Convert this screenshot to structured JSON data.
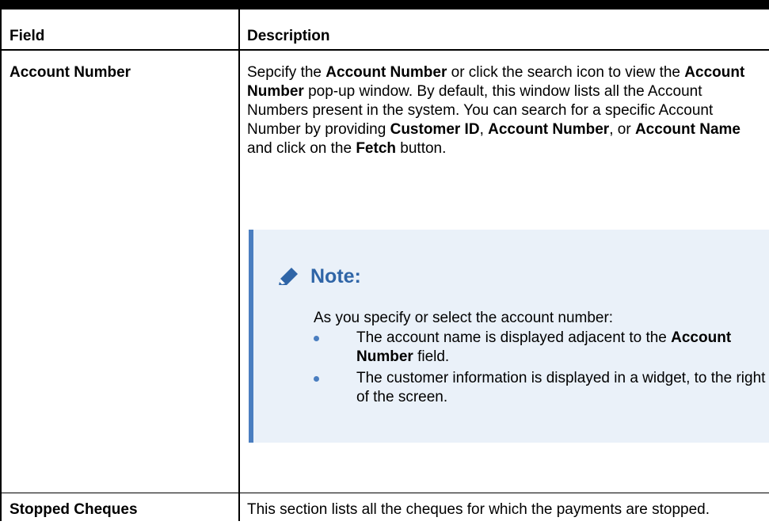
{
  "table": {
    "headers": {
      "field": "Field",
      "description": "Description"
    },
    "rows": [
      {
        "field": "Account Number",
        "desc_parts": {
          "p1": "Sepcify the ",
          "b1": "Account Number",
          "p2": " or click the search icon to view the ",
          "b2": "Account Number",
          "p3": " pop-up window. By default, this window lists all the Account Numbers present in the system. You can search for a specific Account Number by providing ",
          "b3": "Customer ID",
          "p4": ", ",
          "b4": "Account Number",
          "p5": ", or ",
          "b5": "Account Name",
          "p6": " and click on the ",
          "b6": "Fetch",
          "p7": " button."
        },
        "note": {
          "title": "Note:",
          "icon": "pencil-icon",
          "intro": "As you specify or select the account number:",
          "bullet1": {
            "t1": "The account name is displayed adjacent to the ",
            "b1": "Account Number",
            "t2": " field."
          },
          "bullet2": "The customer information is displayed in a widget, to the right of the screen."
        }
      },
      {
        "field": "Stopped Cheques",
        "desc": "This section lists all the cheques for which the payments are stopped."
      }
    ]
  },
  "colors": {
    "note_background": "#eaf1f9",
    "note_accent": "#4a7ec0",
    "note_title": "#2f65a7"
  }
}
